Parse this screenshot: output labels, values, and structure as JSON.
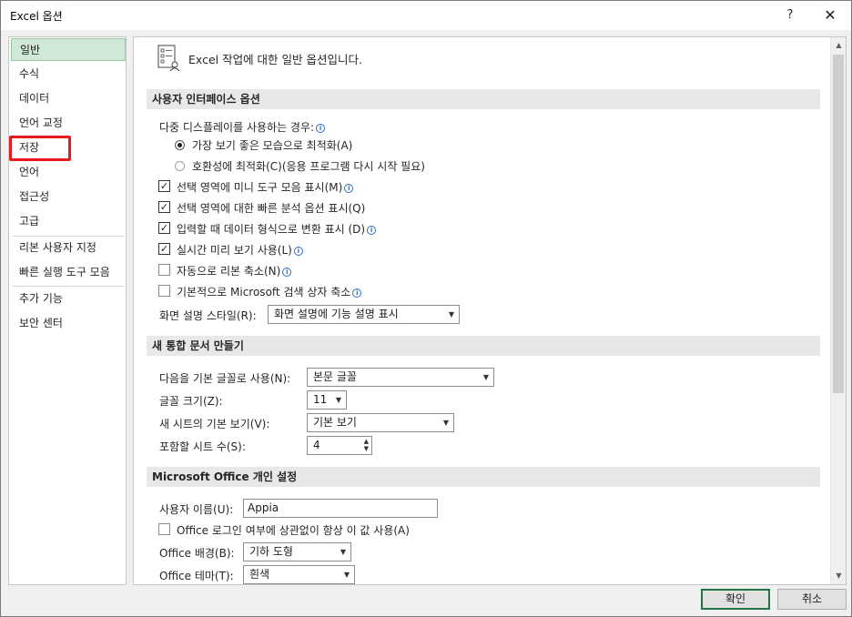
{
  "window": {
    "title": "Excel 옵션",
    "help": "?",
    "close": "✕"
  },
  "sidebar": {
    "items": [
      "일반",
      "수식",
      "데이터",
      "언어 교정",
      "저장",
      "언어",
      "접근성",
      "고급",
      "리본 사용자 지정",
      "빠른 실행 도구 모음",
      "추가 기능",
      "보안 센터"
    ],
    "selected": "일반"
  },
  "header": {
    "text": "Excel 작업에 대한 일반 옵션입니다."
  },
  "ui_options": {
    "section_title": "사용자 인터페이스 옵션",
    "multi_display_label": "다중 디스플레이를 사용하는 경우:",
    "radio_optimize_appearance": "가장 보기 좋은 모습으로 최적화(A)",
    "radio_optimize_compat": "호환성에 최적화(C)(응용 프로그램 다시 시작 필요)",
    "cb_mini_toolbar": "선택 영역에 미니 도구 모음 표시(M)",
    "cb_quick_analysis": "선택 영역에 대한 빠른 분석 옵션 표시(Q)",
    "cb_convert_data": "입력할 때 데이터 형식으로 변환 표시 (D)",
    "cb_live_preview": "실시간 미리 보기 사용(L)",
    "cb_collapse_ribbon": "자동으로 리본 축소(N)",
    "cb_collapse_search": "기본적으로 Microsoft 검색 상자 축소",
    "screentip_label": "화면 설명 스타일(R):",
    "screentip_value": "화면 설명에 기능 설명 표시"
  },
  "new_workbook": {
    "section_title": "새 통합 문서 만들기",
    "font_label": "다음을 기본 글꼴로 사용(N):",
    "font_value": "본문 글꼴",
    "size_label": "글꼴 크기(Z):",
    "size_value": "11",
    "view_label": "새 시트의 기본 보기(V):",
    "view_value": "기본 보기",
    "sheets_label": "포함할 시트 수(S):",
    "sheets_value": "4"
  },
  "personalize": {
    "section_title": "Microsoft Office 개인 설정",
    "username_label": "사용자 이름(U):",
    "username_value": "Appia",
    "always_use_label": "Office 로그인 여부에 상관없이 항상 이 값 사용(A)",
    "background_label": "Office 배경(B):",
    "background_value": "기하 도형",
    "theme_label": "Office 테마(T):",
    "theme_value": "흰색"
  },
  "buttons": {
    "ok": "확인",
    "cancel": "취소"
  },
  "colors": {
    "selected_nav": "#cfe8d7",
    "highlight": "#e6191e",
    "accent": "#217346"
  }
}
